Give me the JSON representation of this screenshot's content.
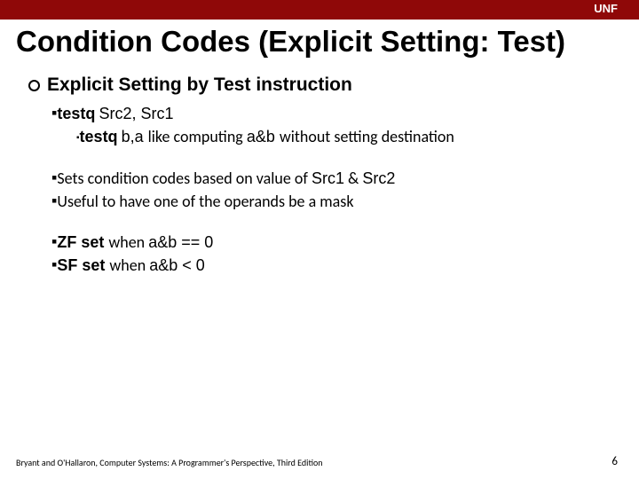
{
  "header": {
    "label": "UNF"
  },
  "title": "Condition Codes (Explicit Setting: Test)",
  "heading": "Explicit Setting by Test instruction",
  "b1": {
    "code": "testq",
    "args": "Src2, Src1"
  },
  "b1sub": {
    "code": "testq",
    "args_pre": "b,a ",
    "mid": "like computing ",
    "expr": "a&b ",
    "tail": "without setting destination"
  },
  "b2": {
    "pre": "Sets condition codes based on value of ",
    "src1": "Src1",
    "amp": " & ",
    "src2": "Src2"
  },
  "b3": "Useful to have one of the operands be a mask",
  "b4": {
    "flag": "ZF set ",
    "when": "when ",
    "cond": "a&b == 0"
  },
  "b5": {
    "flag": "SF set ",
    "when": "when ",
    "cond": "a&b < 0"
  },
  "footer": "Bryant and O'Hallaron, Computer Systems: A Programmer's Perspective, Third Edition",
  "page": "6"
}
